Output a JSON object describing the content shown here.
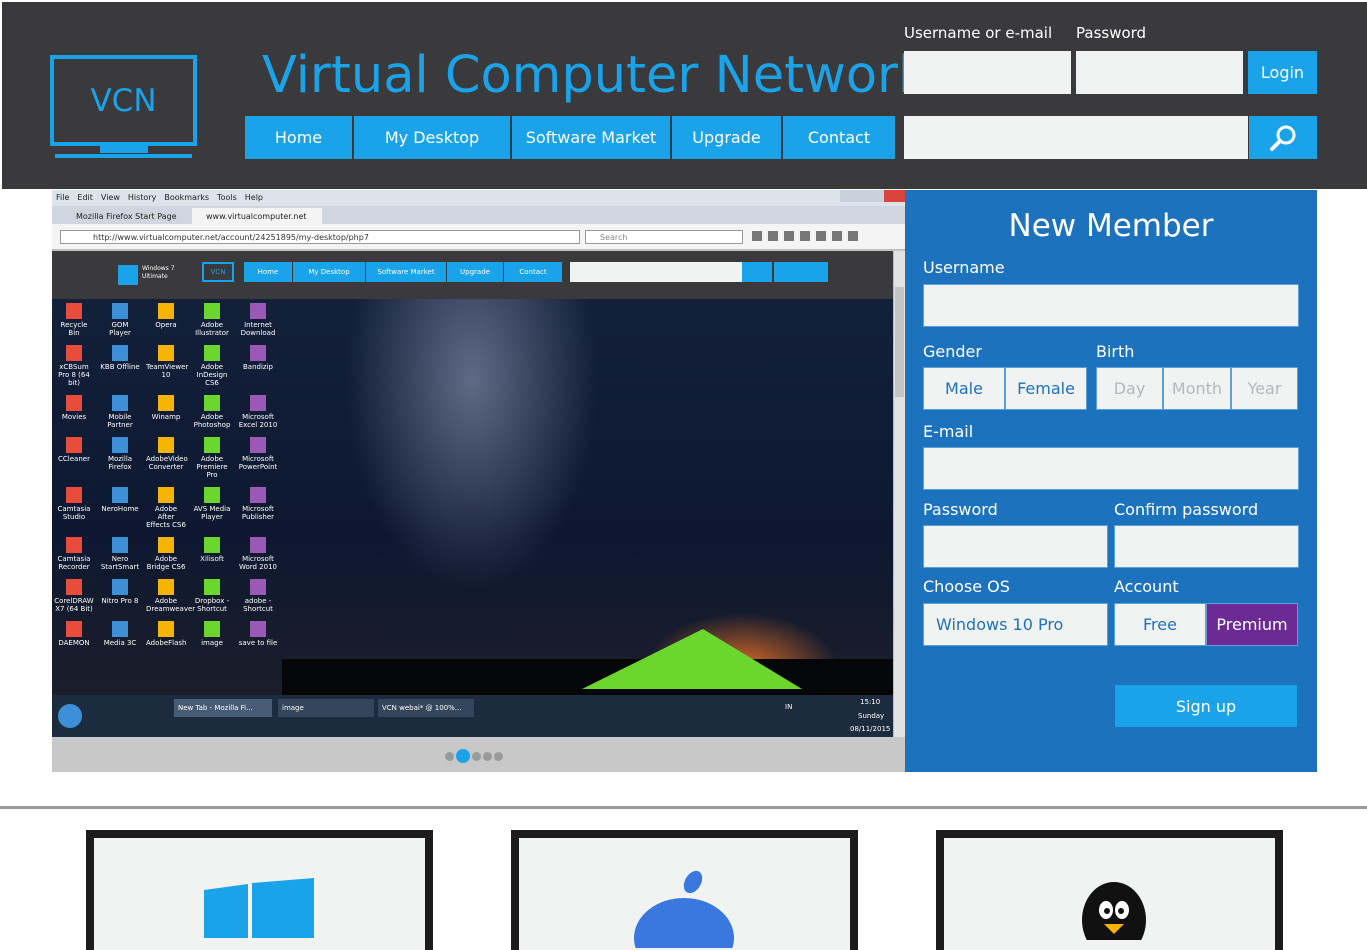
{
  "header": {
    "logo_text": "VCN",
    "title": "Virtual Computer Network",
    "nav": [
      {
        "label": "Home"
      },
      {
        "label": "My Desktop"
      },
      {
        "label": "Software Market"
      },
      {
        "label": "Upgrade"
      },
      {
        "label": "Contact"
      }
    ],
    "username_label": "Username or e-mail",
    "password_label": "Password",
    "login_label": "Login",
    "accent": "#1aa3e8",
    "background": "#3a3a3c"
  },
  "browser": {
    "menu": [
      "File",
      "Edit",
      "View",
      "History",
      "Bookmarks",
      "Tools",
      "Help"
    ],
    "tabs": [
      "Mozilla Firefox Start Page",
      "www.virtualcomputer.net"
    ],
    "url": "http://www.virtualcomputer.net/account/24251895/my-desktop/php7",
    "search_placeholder": "Search",
    "inner_logo": "Windows 7 Ultimate",
    "inner_vcn": "VCN",
    "inner_nav": [
      "Home",
      "My Desktop",
      "Software Market",
      "Upgrade",
      "Contact"
    ],
    "desktop_icons": [
      "Recycle Bin",
      "GOM Player",
      "Opera",
      "Adobe Illustrator",
      "Internet Download",
      "xCBSum Pro 8 (64 bit)",
      "KBB Offline",
      "TeamViewer 10",
      "Adobe InDesign CS6",
      "Bandizip",
      "Movies",
      "Mobile Partner",
      "Winamp",
      "Adobe Photoshop",
      "Microsoft Excel 2010",
      "CCleaner",
      "Mozilla Firefox",
      "AdobeVideo Converter",
      "Adobe Premiere Pro",
      "Microsoft PowerPoint",
      "Camtasia Studio",
      "NeroHome",
      "Adobe After Effects CS6",
      "AVS Media Player",
      "Microsoft Publisher",
      "Camtasia Recorder",
      "Nero StartSmart",
      "Adobe Bridge CS6",
      "Xilisoft",
      "Microsoft Word 2010",
      "CorelDRAW X7 (64 Bit)",
      "Nitro Pro 8",
      "Adobe Dreamweaver",
      "Dropbox - Shortcut",
      "adobe - Shortcut",
      "DAEMON",
      "Media 3C",
      "AdobeFlash",
      "image",
      "save to file"
    ],
    "taskbar_items": [
      "New Tab - Mozilla Fi...",
      "image",
      "VCN webai* @ 100%..."
    ],
    "taskbar_time": "15:10",
    "taskbar_day": "Sunday",
    "taskbar_date": "08/11/2015",
    "taskbar_lang": "IN",
    "slides": 5,
    "active_slide": 2
  },
  "member": {
    "title": "New Member",
    "username_label": "Username",
    "gender_label": "Gender",
    "birth_label": "Birth",
    "gender_options": [
      "Male",
      "Female"
    ],
    "birth_placeholders": [
      "Day",
      "Month",
      "Year"
    ],
    "email_label": "E-mail",
    "password_label": "Password",
    "confirm_label": "Confirm password",
    "os_label": "Choose OS",
    "os_value": "Windows 10 Pro",
    "account_label": "Account",
    "account_options": [
      "Free",
      "Premium"
    ],
    "signup_label": "Sign up",
    "panel_color": "#1d72bd",
    "premium_color": "#6b2a94"
  },
  "os_cards": [
    "windows-logo",
    "apple-logo",
    "linux-tux-logo"
  ]
}
